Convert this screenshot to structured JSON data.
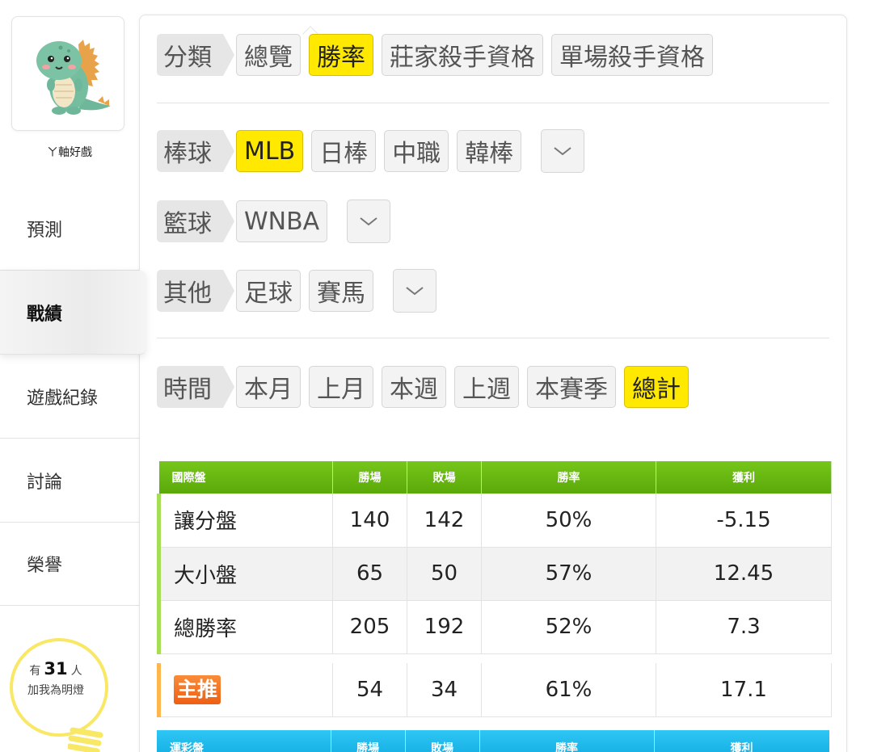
{
  "sidebar": {
    "username": "ㄚ軸好戲",
    "nav": [
      {
        "label": "預測",
        "active": false
      },
      {
        "label": "戰績",
        "active": true
      },
      {
        "label": "遊戲紀錄",
        "active": false
      },
      {
        "label": "討論",
        "active": false
      },
      {
        "label": "榮譽",
        "active": false
      }
    ],
    "lamp": {
      "prefix": "有",
      "count": "31",
      "suffix": "人",
      "line2": "加我為明燈"
    }
  },
  "filters": {
    "category": {
      "label": "分類",
      "chips": [
        "總覽",
        "勝率",
        "莊家殺手資格",
        "單場殺手資格"
      ],
      "selected": "勝率"
    },
    "baseball": {
      "label": "棒球",
      "chips": [
        "MLB",
        "日棒",
        "中職",
        "韓棒"
      ],
      "selected": "MLB"
    },
    "basketball": {
      "label": "籃球",
      "chips": [
        "WNBA"
      ],
      "selected": ""
    },
    "other": {
      "label": "其他",
      "chips": [
        "足球",
        "賽馬"
      ],
      "selected": ""
    },
    "time": {
      "label": "時間",
      "chips": [
        "本月",
        "上月",
        "本週",
        "上週",
        "本賽季",
        "總計"
      ],
      "selected": "總計"
    }
  },
  "table_intl": {
    "headers": [
      "國際盤",
      "勝場",
      "敗場",
      "勝率",
      "獲利"
    ],
    "rows": [
      [
        "讓分盤",
        "140",
        "142",
        "50%",
        "-5.15"
      ],
      [
        "大小盤",
        "65",
        "50",
        "57%",
        "12.45"
      ],
      [
        "總勝率",
        "205",
        "192",
        "52%",
        "7.3"
      ]
    ],
    "featured": {
      "badge": "主推",
      "wins": "54",
      "losses": "34",
      "rate": "61%",
      "profit": "17.1"
    }
  },
  "table_lottery": {
    "headers": [
      "運彩盤",
      "勝場",
      "敗場",
      "勝率",
      "獲利"
    ]
  },
  "colors": {
    "selected_chip": "#ffe900",
    "intl_header": "#5aa90a",
    "lottery_header": "#0fa9e0",
    "badge": "#ee5f14",
    "lamp": "#f8e865"
  }
}
